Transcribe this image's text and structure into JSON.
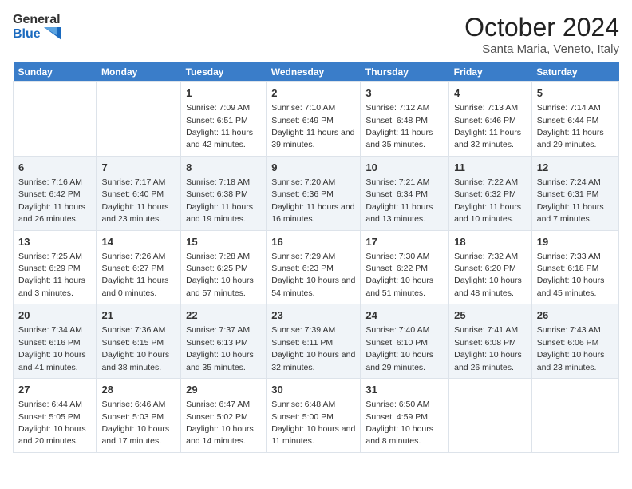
{
  "logo": {
    "line1": "General",
    "line2": "Blue"
  },
  "title": "October 2024",
  "subtitle": "Santa Maria, Veneto, Italy",
  "weekdays": [
    "Sunday",
    "Monday",
    "Tuesday",
    "Wednesday",
    "Thursday",
    "Friday",
    "Saturday"
  ],
  "weeks": [
    [
      {
        "day": "",
        "info": ""
      },
      {
        "day": "",
        "info": ""
      },
      {
        "day": "1",
        "info": "Sunrise: 7:09 AM\nSunset: 6:51 PM\nDaylight: 11 hours and 42 minutes."
      },
      {
        "day": "2",
        "info": "Sunrise: 7:10 AM\nSunset: 6:49 PM\nDaylight: 11 hours and 39 minutes."
      },
      {
        "day": "3",
        "info": "Sunrise: 7:12 AM\nSunset: 6:48 PM\nDaylight: 11 hours and 35 minutes."
      },
      {
        "day": "4",
        "info": "Sunrise: 7:13 AM\nSunset: 6:46 PM\nDaylight: 11 hours and 32 minutes."
      },
      {
        "day": "5",
        "info": "Sunrise: 7:14 AM\nSunset: 6:44 PM\nDaylight: 11 hours and 29 minutes."
      }
    ],
    [
      {
        "day": "6",
        "info": "Sunrise: 7:16 AM\nSunset: 6:42 PM\nDaylight: 11 hours and 26 minutes."
      },
      {
        "day": "7",
        "info": "Sunrise: 7:17 AM\nSunset: 6:40 PM\nDaylight: 11 hours and 23 minutes."
      },
      {
        "day": "8",
        "info": "Sunrise: 7:18 AM\nSunset: 6:38 PM\nDaylight: 11 hours and 19 minutes."
      },
      {
        "day": "9",
        "info": "Sunrise: 7:20 AM\nSunset: 6:36 PM\nDaylight: 11 hours and 16 minutes."
      },
      {
        "day": "10",
        "info": "Sunrise: 7:21 AM\nSunset: 6:34 PM\nDaylight: 11 hours and 13 minutes."
      },
      {
        "day": "11",
        "info": "Sunrise: 7:22 AM\nSunset: 6:32 PM\nDaylight: 11 hours and 10 minutes."
      },
      {
        "day": "12",
        "info": "Sunrise: 7:24 AM\nSunset: 6:31 PM\nDaylight: 11 hours and 7 minutes."
      }
    ],
    [
      {
        "day": "13",
        "info": "Sunrise: 7:25 AM\nSunset: 6:29 PM\nDaylight: 11 hours and 3 minutes."
      },
      {
        "day": "14",
        "info": "Sunrise: 7:26 AM\nSunset: 6:27 PM\nDaylight: 11 hours and 0 minutes."
      },
      {
        "day": "15",
        "info": "Sunrise: 7:28 AM\nSunset: 6:25 PM\nDaylight: 10 hours and 57 minutes."
      },
      {
        "day": "16",
        "info": "Sunrise: 7:29 AM\nSunset: 6:23 PM\nDaylight: 10 hours and 54 minutes."
      },
      {
        "day": "17",
        "info": "Sunrise: 7:30 AM\nSunset: 6:22 PM\nDaylight: 10 hours and 51 minutes."
      },
      {
        "day": "18",
        "info": "Sunrise: 7:32 AM\nSunset: 6:20 PM\nDaylight: 10 hours and 48 minutes."
      },
      {
        "day": "19",
        "info": "Sunrise: 7:33 AM\nSunset: 6:18 PM\nDaylight: 10 hours and 45 minutes."
      }
    ],
    [
      {
        "day": "20",
        "info": "Sunrise: 7:34 AM\nSunset: 6:16 PM\nDaylight: 10 hours and 41 minutes."
      },
      {
        "day": "21",
        "info": "Sunrise: 7:36 AM\nSunset: 6:15 PM\nDaylight: 10 hours and 38 minutes."
      },
      {
        "day": "22",
        "info": "Sunrise: 7:37 AM\nSunset: 6:13 PM\nDaylight: 10 hours and 35 minutes."
      },
      {
        "day": "23",
        "info": "Sunrise: 7:39 AM\nSunset: 6:11 PM\nDaylight: 10 hours and 32 minutes."
      },
      {
        "day": "24",
        "info": "Sunrise: 7:40 AM\nSunset: 6:10 PM\nDaylight: 10 hours and 29 minutes."
      },
      {
        "day": "25",
        "info": "Sunrise: 7:41 AM\nSunset: 6:08 PM\nDaylight: 10 hours and 26 minutes."
      },
      {
        "day": "26",
        "info": "Sunrise: 7:43 AM\nSunset: 6:06 PM\nDaylight: 10 hours and 23 minutes."
      }
    ],
    [
      {
        "day": "27",
        "info": "Sunrise: 6:44 AM\nSunset: 5:05 PM\nDaylight: 10 hours and 20 minutes."
      },
      {
        "day": "28",
        "info": "Sunrise: 6:46 AM\nSunset: 5:03 PM\nDaylight: 10 hours and 17 minutes."
      },
      {
        "day": "29",
        "info": "Sunrise: 6:47 AM\nSunset: 5:02 PM\nDaylight: 10 hours and 14 minutes."
      },
      {
        "day": "30",
        "info": "Sunrise: 6:48 AM\nSunset: 5:00 PM\nDaylight: 10 hours and 11 minutes."
      },
      {
        "day": "31",
        "info": "Sunrise: 6:50 AM\nSunset: 4:59 PM\nDaylight: 10 hours and 8 minutes."
      },
      {
        "day": "",
        "info": ""
      },
      {
        "day": "",
        "info": ""
      }
    ]
  ]
}
